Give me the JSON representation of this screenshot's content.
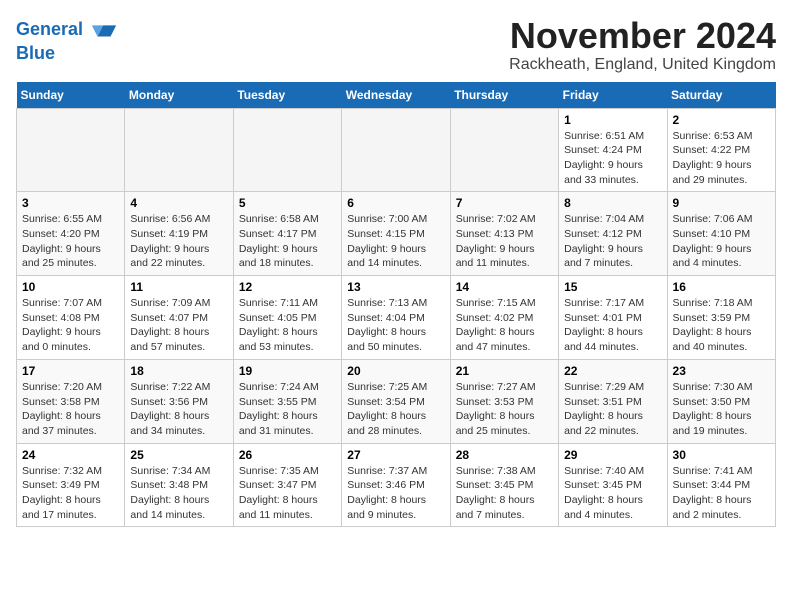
{
  "header": {
    "logo_line1": "General",
    "logo_line2": "Blue",
    "title": "November 2024",
    "subtitle": "Rackheath, England, United Kingdom"
  },
  "days_of_week": [
    "Sunday",
    "Monday",
    "Tuesday",
    "Wednesday",
    "Thursday",
    "Friday",
    "Saturday"
  ],
  "weeks": [
    [
      {
        "day": "",
        "info": ""
      },
      {
        "day": "",
        "info": ""
      },
      {
        "day": "",
        "info": ""
      },
      {
        "day": "",
        "info": ""
      },
      {
        "day": "",
        "info": ""
      },
      {
        "day": "1",
        "info": "Sunrise: 6:51 AM\nSunset: 4:24 PM\nDaylight: 9 hours and 33 minutes."
      },
      {
        "day": "2",
        "info": "Sunrise: 6:53 AM\nSunset: 4:22 PM\nDaylight: 9 hours and 29 minutes."
      }
    ],
    [
      {
        "day": "3",
        "info": "Sunrise: 6:55 AM\nSunset: 4:20 PM\nDaylight: 9 hours and 25 minutes."
      },
      {
        "day": "4",
        "info": "Sunrise: 6:56 AM\nSunset: 4:19 PM\nDaylight: 9 hours and 22 minutes."
      },
      {
        "day": "5",
        "info": "Sunrise: 6:58 AM\nSunset: 4:17 PM\nDaylight: 9 hours and 18 minutes."
      },
      {
        "day": "6",
        "info": "Sunrise: 7:00 AM\nSunset: 4:15 PM\nDaylight: 9 hours and 14 minutes."
      },
      {
        "day": "7",
        "info": "Sunrise: 7:02 AM\nSunset: 4:13 PM\nDaylight: 9 hours and 11 minutes."
      },
      {
        "day": "8",
        "info": "Sunrise: 7:04 AM\nSunset: 4:12 PM\nDaylight: 9 hours and 7 minutes."
      },
      {
        "day": "9",
        "info": "Sunrise: 7:06 AM\nSunset: 4:10 PM\nDaylight: 9 hours and 4 minutes."
      }
    ],
    [
      {
        "day": "10",
        "info": "Sunrise: 7:07 AM\nSunset: 4:08 PM\nDaylight: 9 hours and 0 minutes."
      },
      {
        "day": "11",
        "info": "Sunrise: 7:09 AM\nSunset: 4:07 PM\nDaylight: 8 hours and 57 minutes."
      },
      {
        "day": "12",
        "info": "Sunrise: 7:11 AM\nSunset: 4:05 PM\nDaylight: 8 hours and 53 minutes."
      },
      {
        "day": "13",
        "info": "Sunrise: 7:13 AM\nSunset: 4:04 PM\nDaylight: 8 hours and 50 minutes."
      },
      {
        "day": "14",
        "info": "Sunrise: 7:15 AM\nSunset: 4:02 PM\nDaylight: 8 hours and 47 minutes."
      },
      {
        "day": "15",
        "info": "Sunrise: 7:17 AM\nSunset: 4:01 PM\nDaylight: 8 hours and 44 minutes."
      },
      {
        "day": "16",
        "info": "Sunrise: 7:18 AM\nSunset: 3:59 PM\nDaylight: 8 hours and 40 minutes."
      }
    ],
    [
      {
        "day": "17",
        "info": "Sunrise: 7:20 AM\nSunset: 3:58 PM\nDaylight: 8 hours and 37 minutes."
      },
      {
        "day": "18",
        "info": "Sunrise: 7:22 AM\nSunset: 3:56 PM\nDaylight: 8 hours and 34 minutes."
      },
      {
        "day": "19",
        "info": "Sunrise: 7:24 AM\nSunset: 3:55 PM\nDaylight: 8 hours and 31 minutes."
      },
      {
        "day": "20",
        "info": "Sunrise: 7:25 AM\nSunset: 3:54 PM\nDaylight: 8 hours and 28 minutes."
      },
      {
        "day": "21",
        "info": "Sunrise: 7:27 AM\nSunset: 3:53 PM\nDaylight: 8 hours and 25 minutes."
      },
      {
        "day": "22",
        "info": "Sunrise: 7:29 AM\nSunset: 3:51 PM\nDaylight: 8 hours and 22 minutes."
      },
      {
        "day": "23",
        "info": "Sunrise: 7:30 AM\nSunset: 3:50 PM\nDaylight: 8 hours and 19 minutes."
      }
    ],
    [
      {
        "day": "24",
        "info": "Sunrise: 7:32 AM\nSunset: 3:49 PM\nDaylight: 8 hours and 17 minutes."
      },
      {
        "day": "25",
        "info": "Sunrise: 7:34 AM\nSunset: 3:48 PM\nDaylight: 8 hours and 14 minutes."
      },
      {
        "day": "26",
        "info": "Sunrise: 7:35 AM\nSunset: 3:47 PM\nDaylight: 8 hours and 11 minutes."
      },
      {
        "day": "27",
        "info": "Sunrise: 7:37 AM\nSunset: 3:46 PM\nDaylight: 8 hours and 9 minutes."
      },
      {
        "day": "28",
        "info": "Sunrise: 7:38 AM\nSunset: 3:45 PM\nDaylight: 8 hours and 7 minutes."
      },
      {
        "day": "29",
        "info": "Sunrise: 7:40 AM\nSunset: 3:45 PM\nDaylight: 8 hours and 4 minutes."
      },
      {
        "day": "30",
        "info": "Sunrise: 7:41 AM\nSunset: 3:44 PM\nDaylight: 8 hours and 2 minutes."
      }
    ]
  ]
}
